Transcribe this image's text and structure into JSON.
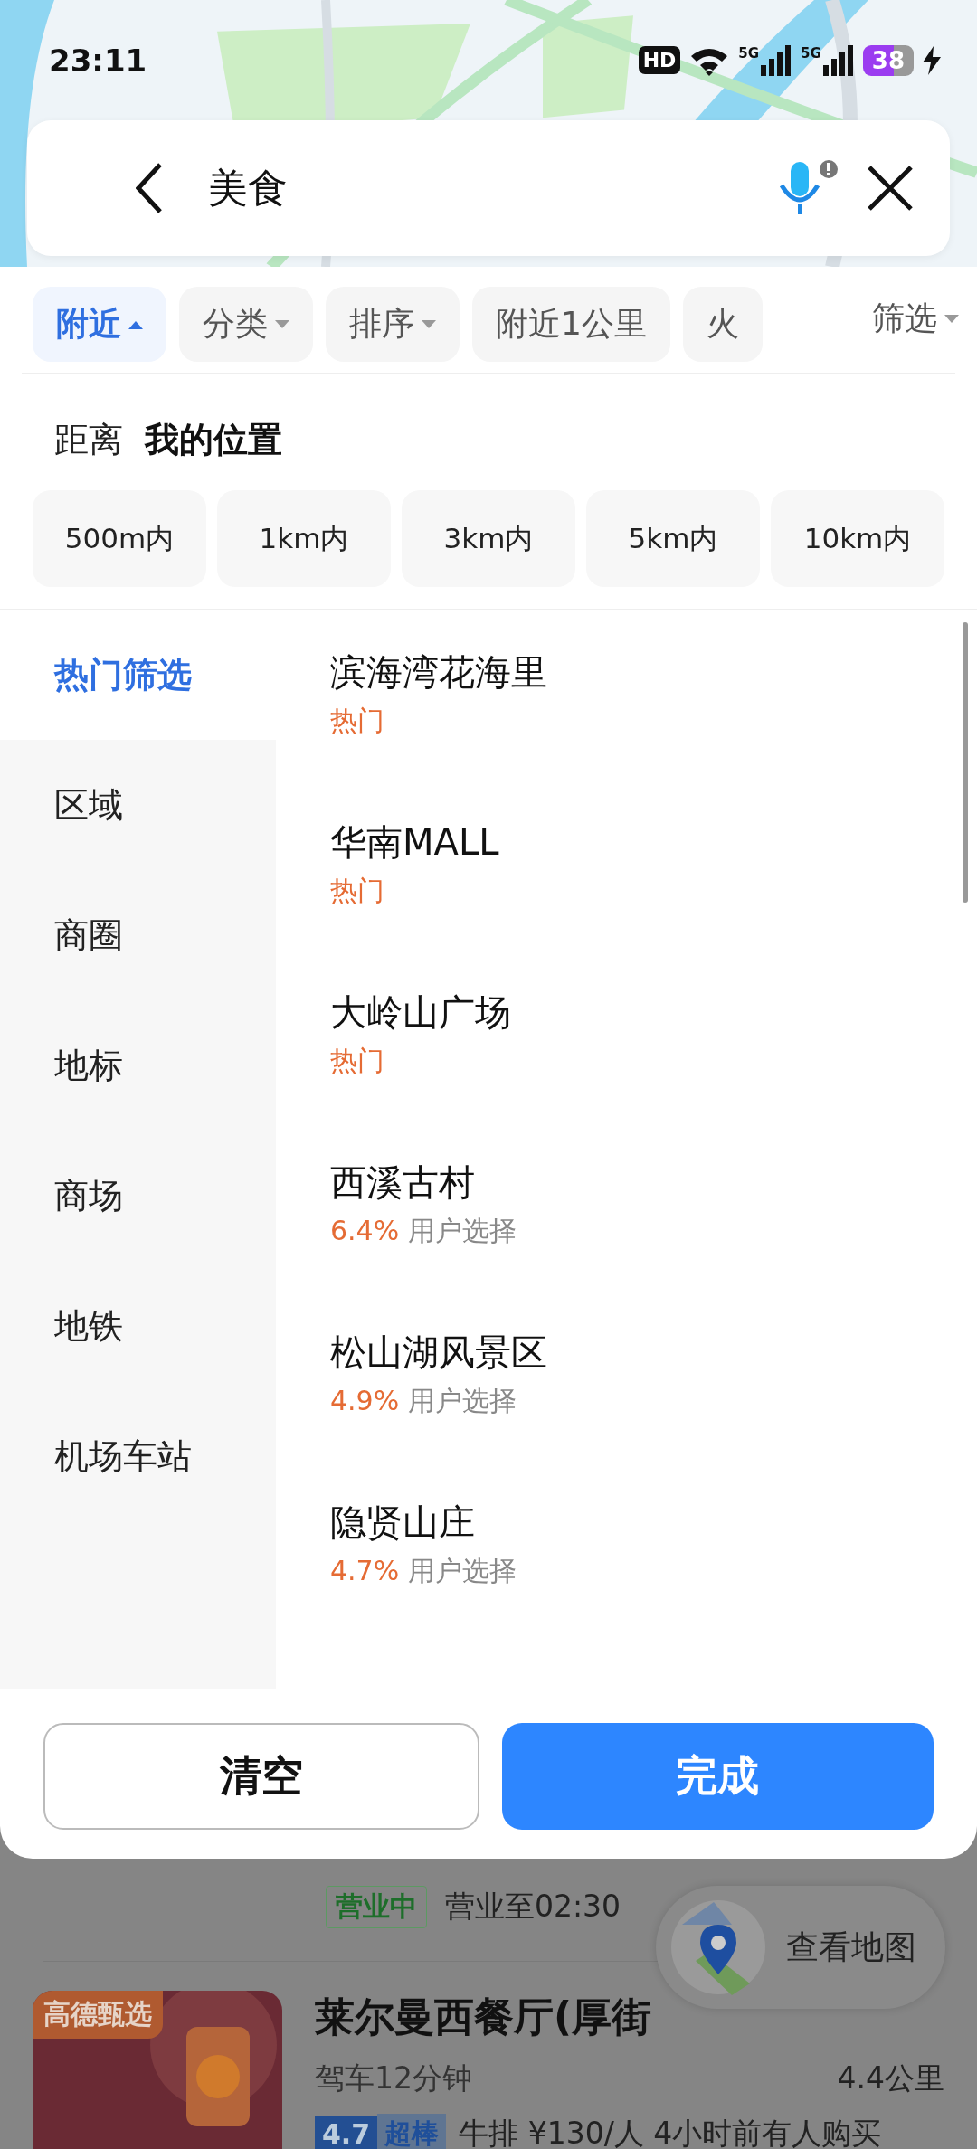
{
  "status_bar": {
    "time": "23:11",
    "hd": "HD",
    "signals": [
      "5G",
      "5G"
    ],
    "battery": "38"
  },
  "search": {
    "value": "美食"
  },
  "filter_chips": [
    {
      "label": "附近",
      "selected": true,
      "dropdown": true
    },
    {
      "label": "分类",
      "selected": false,
      "dropdown": true
    },
    {
      "label": "排序",
      "selected": false,
      "dropdown": true
    },
    {
      "label": "附近1公里",
      "selected": false,
      "dropdown": false
    },
    {
      "label": "火",
      "selected": false,
      "dropdown": false
    }
  ],
  "filter_button": {
    "label": "筛选"
  },
  "distance": {
    "label": "距离",
    "origin": "我的位置",
    "options": [
      {
        "label": "500m内",
        "selected": false
      },
      {
        "label": "1km内",
        "selected": false
      },
      {
        "label": "3km内",
        "selected": false
      },
      {
        "label": "5km内",
        "selected": false
      },
      {
        "label": "10km内",
        "selected": false
      }
    ]
  },
  "categories": [
    {
      "label": "热门筛选",
      "selected": true
    },
    {
      "label": "区域",
      "selected": false
    },
    {
      "label": "商圈",
      "selected": false
    },
    {
      "label": "地标",
      "selected": false
    },
    {
      "label": "商场",
      "selected": false
    },
    {
      "label": "地铁",
      "selected": false
    },
    {
      "label": "机场车站",
      "selected": false
    }
  ],
  "places": [
    {
      "name": "滨海湾花海里",
      "kind": "hot",
      "tag": "热门"
    },
    {
      "name": "华南MALL",
      "kind": "hot",
      "tag": "热门"
    },
    {
      "name": "大岭山广场",
      "kind": "hot",
      "tag": "热门"
    },
    {
      "name": "西溪古村",
      "kind": "share",
      "share": "6.4%",
      "note": "用户选择"
    },
    {
      "name": "松山湖风景区",
      "kind": "share",
      "share": "4.9%",
      "note": "用户选择"
    },
    {
      "name": "隐贤山庄",
      "kind": "share",
      "share": "4.7%",
      "note": "用户选择"
    }
  ],
  "actions": {
    "clear": "清空",
    "done": "完成"
  },
  "behind": {
    "open_status": "营业中",
    "hours": "营业至02:30",
    "badge": "高德甄选",
    "name": "莱尔曼西餐厅(厚街",
    "drive": "驾车12分钟",
    "distance": "4.4公里",
    "rating": "4.7",
    "rating_label": "超棒",
    "info": "牛排 ¥130/人 4小时前有人购买",
    "map_button": "查看地图"
  }
}
